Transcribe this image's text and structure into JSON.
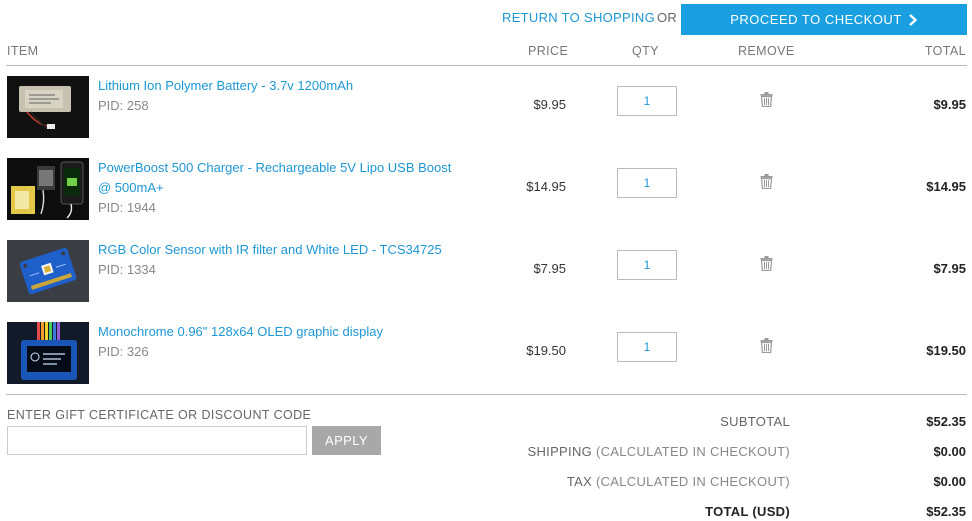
{
  "header": {
    "return_link": "RETURN TO SHOPPING",
    "or": "OR",
    "checkout": "PROCEED TO CHECKOUT"
  },
  "columns": {
    "item": "ITEM",
    "price": "PRICE",
    "qty": "QTY",
    "remove": "REMOVE",
    "total": "TOTAL"
  },
  "items": [
    {
      "name": "Lithium Ion Polymer Battery - 3.7v 1200mAh",
      "pid": "PID: 258",
      "price": "$9.95",
      "qty": "1",
      "total": "$9.95",
      "image": "battery"
    },
    {
      "name": "PowerBoost 500 Charger - Rechargeable 5V Lipo USB Boost @ 500mA+",
      "pid": "PID: 1944",
      "price": "$14.95",
      "qty": "1",
      "total": "$14.95",
      "image": "charger-board"
    },
    {
      "name": "RGB Color Sensor with IR filter and White LED - TCS34725",
      "pid": "PID: 1334",
      "price": "$7.95",
      "qty": "1",
      "total": "$7.95",
      "image": "sensor-board"
    },
    {
      "name": "Monochrome 0.96\" 128x64 OLED graphic display",
      "pid": "PID: 326",
      "price": "$19.50",
      "qty": "1",
      "total": "$19.50",
      "image": "oled-display"
    }
  ],
  "gift": {
    "label": "ENTER GIFT CERTIFICATE OR DISCOUNT CODE",
    "placeholder": "",
    "apply": "APPLY"
  },
  "summary": {
    "subtotal_label": "SUBTOTAL",
    "subtotal": "$52.35",
    "shipping_label": "SHIPPING",
    "shipping_note": "(CALCULATED IN CHECKOUT)",
    "shipping": "$0.00",
    "tax_label": "TAX",
    "tax_note": "(CALCULATED IN CHECKOUT)",
    "tax": "$0.00",
    "total_label": "TOTAL (USD)",
    "total": "$52.35"
  },
  "icons": {
    "checkout": "chevron-right-icon",
    "remove": "trash-icon"
  },
  "colors": {
    "link": "#1d97d6",
    "checkout_bg": "#1aa0e0",
    "apply_bg": "#a8a8a8"
  }
}
